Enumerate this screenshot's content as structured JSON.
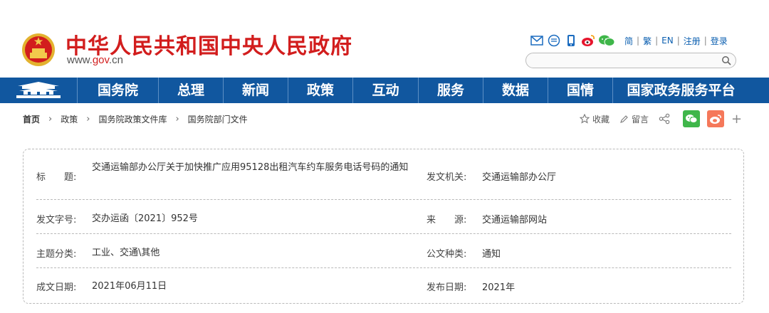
{
  "header": {
    "site_title": "中华人民共和国中央人民政府",
    "site_url_prefix": "www.",
    "site_url_gov": "gov",
    "site_url_suffix": ".cn",
    "links": [
      "简",
      "繁",
      "EN",
      "注册",
      "登录"
    ],
    "search_placeholder": ""
  },
  "nav": {
    "items": [
      "国务院",
      "总理",
      "新闻",
      "政策",
      "互动",
      "服务",
      "数据",
      "国情",
      "国家政务服务平台"
    ]
  },
  "breadcrumb": [
    "首页",
    "政策",
    "国务院政策文件库",
    "国务院部门文件"
  ],
  "share": {
    "favorite": "收藏",
    "comment": "留言",
    "plus": "+"
  },
  "info": {
    "title_label": "标　　题:",
    "title_value": "交通运输部办公厅关于加快推广应用95128出租汽车约车服务电话号码的通知",
    "issuer_label": "发文机关:",
    "issuer_value": "交通运输部办公厅",
    "docno_label": "发文字号:",
    "docno_value": "交办运函〔2021〕952号",
    "source_label": "来　　源:",
    "source_value": "交通运输部网站",
    "category_label": "主题分类:",
    "category_value": "工业、交通\\其他",
    "doctype_label": "公文种类:",
    "doctype_value": "通知",
    "written_label": "成文日期:",
    "written_value": "2021年06月11日",
    "published_label": "发布日期:",
    "published_value": "2021年"
  },
  "colors": {
    "brand_red": "#d21d1d",
    "nav_blue": "#11579f",
    "wechat_green": "#3fb64a",
    "weibo_orange": "#f5785a"
  }
}
